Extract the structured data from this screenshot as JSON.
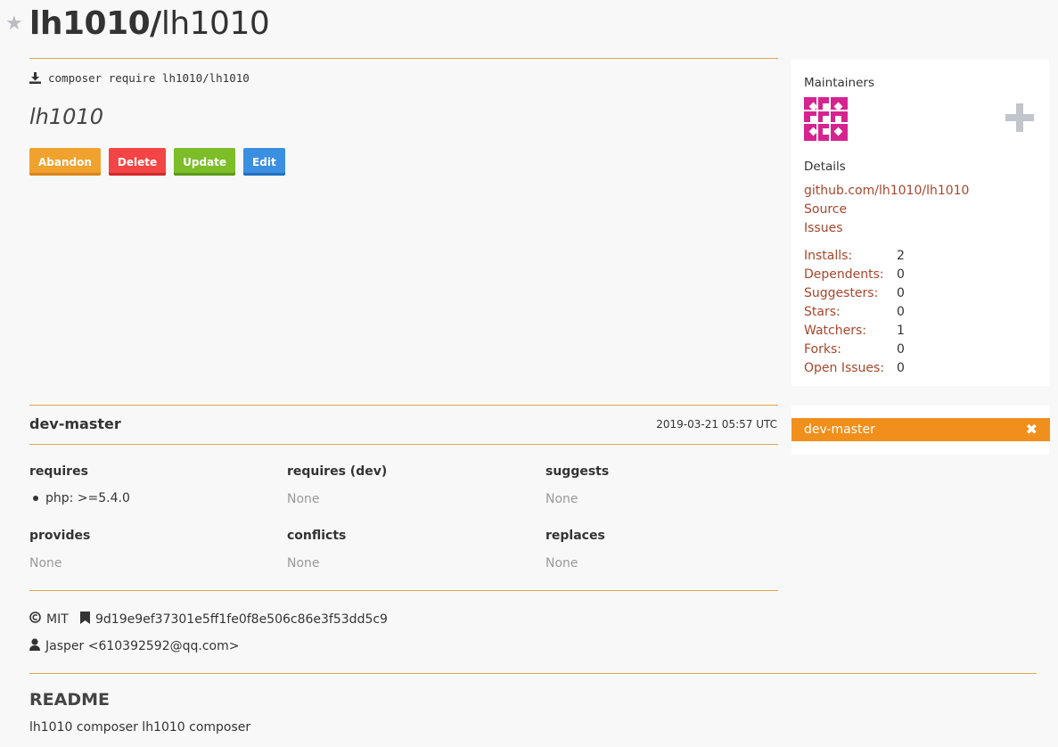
{
  "package": {
    "vendor": "lh1010/",
    "name": "lh1010",
    "install_command": "composer require lh1010/lh1010",
    "description": "lh1010"
  },
  "actions": {
    "abandon": "Abandon",
    "delete": "Delete",
    "update": "Update",
    "edit": "Edit"
  },
  "sidebar": {
    "maintainers_heading": "Maintainers",
    "details_heading": "Details",
    "links": {
      "repo": "github.com/lh1010/lh1010",
      "source": "Source",
      "issues": "Issues"
    },
    "stats": [
      {
        "label": "Installs:",
        "value": "2"
      },
      {
        "label": "Dependents:",
        "value": "0"
      },
      {
        "label": "Suggesters:",
        "value": "0"
      },
      {
        "label": "Stars:",
        "value": "0"
      },
      {
        "label": "Watchers:",
        "value": "1"
      },
      {
        "label": "Forks:",
        "value": "0"
      },
      {
        "label": "Open Issues:",
        "value": "0"
      }
    ],
    "versions": [
      {
        "label": "dev-master"
      }
    ]
  },
  "version": {
    "name": "dev-master",
    "date": "2019-03-21 05:57 UTC",
    "requires": {
      "heading": "requires",
      "items": [
        "php: >=5.4.0"
      ]
    },
    "requires_dev": {
      "heading": "requires (dev)",
      "empty": "None"
    },
    "suggests": {
      "heading": "suggests",
      "empty": "None"
    },
    "provides": {
      "heading": "provides",
      "empty": "None"
    },
    "conflicts": {
      "heading": "conflicts",
      "empty": "None"
    },
    "replaces": {
      "heading": "replaces",
      "empty": "None"
    },
    "license": "MIT",
    "reference": "9d19e9ef37301e5ff1fe0f8e506c86e3f53dd5c9",
    "author": "Jasper <610392592@qq.com>"
  },
  "readme": {
    "heading": "README",
    "body": "lh1010 composer lh1010 composer"
  },
  "colors": {
    "accent": "#f18f1c",
    "link": "#a6462b",
    "avatar": "#d6238f"
  }
}
